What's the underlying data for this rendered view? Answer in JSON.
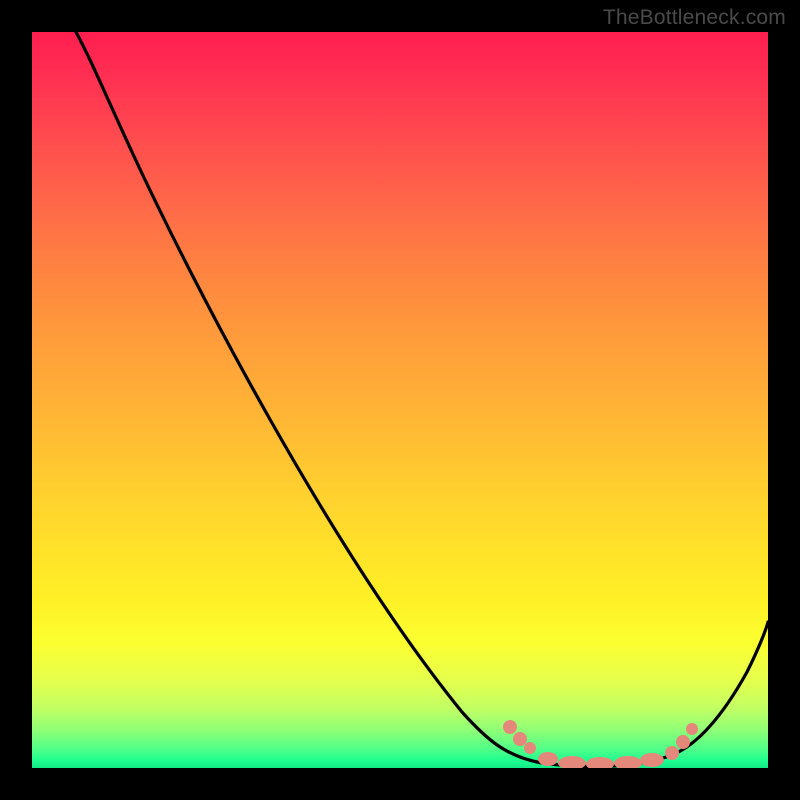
{
  "watermark": "TheBottleneck.com",
  "chart_data": {
    "type": "line",
    "title": "",
    "xlabel": "",
    "ylabel": "",
    "xlim": [
      0,
      100
    ],
    "ylim": [
      0,
      100
    ],
    "grid": false,
    "legend": false,
    "background_gradient": {
      "description": "vertical gradient representing bottleneck severity; red/pink at top = high bottleneck, green at bottom = optimal",
      "stops": [
        {
          "pct": 0,
          "color": "#ff1f50"
        },
        {
          "pct": 50,
          "color": "#ffba34"
        },
        {
          "pct": 80,
          "color": "#fbff30"
        },
        {
          "pct": 100,
          "color": "#14e887"
        }
      ]
    },
    "series": [
      {
        "name": "bottleneck-curve",
        "description": "V-shaped bottleneck curve; y-value is bottleneck percentage (lower = better); minimum near x≈72–86",
        "color": "#000000",
        "x": [
          6,
          10,
          20,
          30,
          40,
          50,
          60,
          65,
          70,
          74,
          78,
          82,
          86,
          90,
          94,
          98,
          100
        ],
        "y": [
          100,
          94,
          79,
          65,
          51,
          37,
          23,
          15,
          7,
          2,
          0,
          0,
          1,
          5,
          12,
          20,
          24
        ],
        "optimal_x_range": [
          72,
          86
        ]
      }
    ],
    "markers": [
      {
        "name": "optimal-range-marker",
        "shape": "dotted-band",
        "color": "#e4887b",
        "points_x": [
          67,
          69,
          71,
          73,
          76,
          79,
          82,
          85,
          87,
          88,
          89
        ],
        "points_y": [
          10,
          6,
          3,
          1,
          0,
          0,
          0,
          0,
          1,
          3,
          6
        ]
      }
    ]
  }
}
